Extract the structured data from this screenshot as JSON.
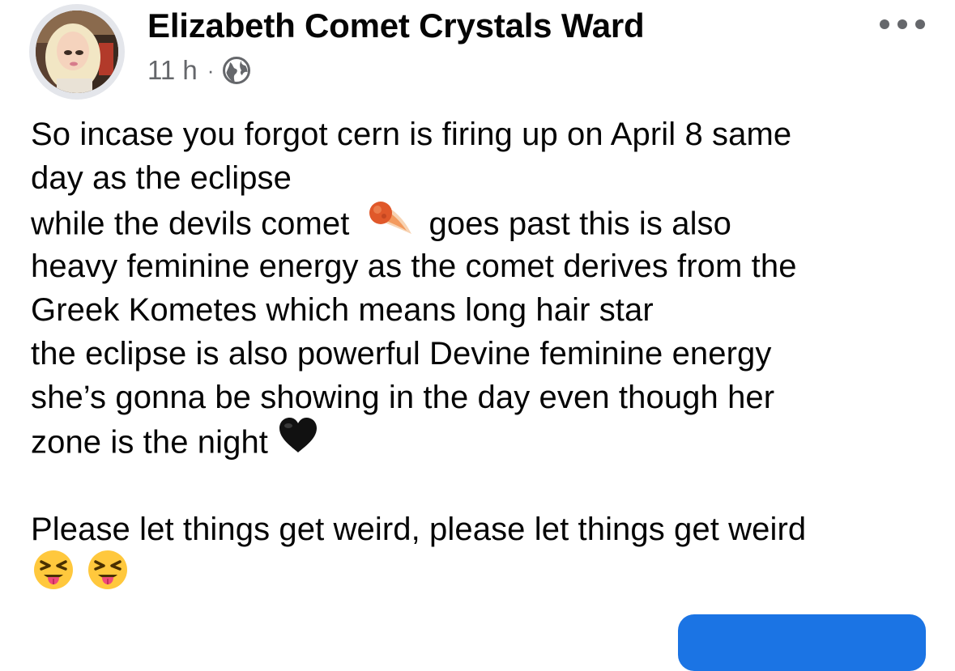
{
  "post": {
    "author": "Elizabeth Comet Crystals Ward",
    "time": "11 h",
    "separator": "·",
    "audience_icon": "globe-icon",
    "more_icon": "more-dots-icon",
    "lines": {
      "l1": "So incase you forgot cern is firing up on April 8  same",
      "l2": "day as the eclipse",
      "l3a": "while the devils comet",
      "l3b": "goes past this is also",
      "l4": "heavy feminine energy as the comet derives from the",
      "l5": "Greek Kometes which means long hair star",
      "l6": "the eclipse is also powerful Devine feminine energy",
      "l7": "she’s gonna be showing in the day even though her",
      "l8": "zone is the night",
      "l9": "Please let things get weird, please let things get weird"
    },
    "emojis": [
      "comet",
      "black-heart",
      "squinting-face-with-tongue",
      "squinting-face-with-tongue"
    ]
  },
  "colors": {
    "text": "#050505",
    "meta": "#65676b",
    "link": "#216fdb",
    "button": "#1b74e4"
  }
}
